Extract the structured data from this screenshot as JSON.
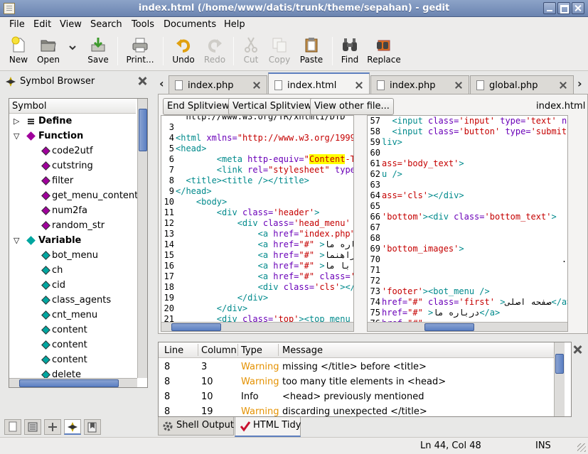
{
  "window": {
    "title": "index.html (/home/www/datis/trunk/theme/sepahan) - gedit"
  },
  "menu": [
    "File",
    "Edit",
    "View",
    "Search",
    "Tools",
    "Documents",
    "Help"
  ],
  "toolbar": {
    "new": "New",
    "open": "Open",
    "save": "Save",
    "print": "Print...",
    "undo": "Undo",
    "redo": "Redo",
    "cut": "Cut",
    "copy": "Copy",
    "paste": "Paste",
    "find": "Find",
    "replace": "Replace"
  },
  "side_panel": {
    "title": "Symbol Browser",
    "column": "Symbol",
    "tree": [
      {
        "label": "Define",
        "kind": "group",
        "expanded": false
      },
      {
        "label": "Function",
        "kind": "group",
        "expanded": true
      },
      {
        "label": "code2utf",
        "kind": "function"
      },
      {
        "label": "cutstring",
        "kind": "function"
      },
      {
        "label": "filter",
        "kind": "function"
      },
      {
        "label": "get_menu_content",
        "kind": "function"
      },
      {
        "label": "num2fa",
        "kind": "function"
      },
      {
        "label": "random_str",
        "kind": "function"
      },
      {
        "label": "Variable",
        "kind": "group",
        "expanded": true
      },
      {
        "label": "bot_menu",
        "kind": "variable"
      },
      {
        "label": "ch",
        "kind": "variable"
      },
      {
        "label": "cid",
        "kind": "variable"
      },
      {
        "label": "class_agents",
        "kind": "variable"
      },
      {
        "label": "cnt_menu",
        "kind": "variable"
      },
      {
        "label": "content",
        "kind": "variable"
      },
      {
        "label": "content",
        "kind": "variable"
      },
      {
        "label": "content",
        "kind": "variable"
      },
      {
        "label": "delete",
        "kind": "variable"
      }
    ]
  },
  "tabs": [
    {
      "label": "index.php",
      "active": false
    },
    {
      "label": "index.html",
      "active": true
    },
    {
      "label": "index.php",
      "active": false
    },
    {
      "label": "global.php",
      "active": false
    }
  ],
  "editor": {
    "buttons": {
      "end": "End Splitview",
      "vertical": "Vertical Splitview",
      "other": "View other file..."
    },
    "filename": "index.html",
    "left_lines": [
      {
        "n": "",
        "html": "  http://www.w3.org/TR/xhtml1/DTD"
      },
      {
        "n": "3",
        "html": ""
      },
      {
        "n": "4",
        "html": "<span class='tg'>&lt;html</span> <span class='at'>xmlns=</span><span class='st'>\"http://www.w3.org/1999/</span>"
      },
      {
        "n": "5",
        "html": "<span class='tg'>&lt;head&gt;</span>"
      },
      {
        "n": "6",
        "html": "        <span class='tg'>&lt;meta</span> <span class='at'>http-equiv=</span><span class='st'>\"<span class='hl'>Content</span>-Ty</span>"
      },
      {
        "n": "7",
        "html": "        <span class='tg'>&lt;link</span> <span class='at'>rel=</span><span class='st'>\"stylesheet\"</span> <span class='at'>type=</span>"
      },
      {
        "n": "8",
        "html": "  <span class='tg'>&lt;title&gt;&lt;title /&gt;&lt;/title&gt;</span>"
      },
      {
        "n": "9",
        "html": "<span class='tg'>&lt;/head&gt;</span>"
      },
      {
        "n": "10",
        "html": "    <span class='tg'>&lt;body&gt;</span>"
      },
      {
        "n": "11",
        "html": "        <span class='tg'>&lt;div</span> <span class='at'>class=</span><span class='st'>'header'</span><span class='tg'>&gt;</span>"
      },
      {
        "n": "12",
        "html": "            <span class='tg'>&lt;div</span> <span class='at'>class=</span><span class='st'>'head_menu'</span> <span class='tg'>&gt;</span>"
      },
      {
        "n": "13",
        "html": "                <span class='tg'>&lt;a</span> <span class='at'>href=</span><span class='st'>\"index.php\"</span>"
      },
      {
        "n": "14",
        "html": "                <span class='tg'>&lt;a</span> <span class='at'>href=</span><span class='st'>\"#\"</span> <span class='tg'>&gt;</span>درباره ما"
      },
      {
        "n": "15",
        "html": "                <span class='tg'>&lt;a</span> <span class='at'>href=</span><span class='st'>\"#\"</span> <span class='tg'>&gt;</span>راهنما"
      },
      {
        "n": "16",
        "html": "                <span class='tg'>&lt;a</span> <span class='at'>href=</span><span class='st'>\"#\"</span> <span class='tg'>&gt;</span>تماس با ما"
      },
      {
        "n": "17",
        "html": "                <span class='tg'>&lt;a</span> <span class='at'>href=</span><span class='st'>\"#\"</span> <span class='at'>class=</span><span class='st'>'f</span>"
      },
      {
        "n": "18",
        "html": "                <span class='tg'>&lt;div</span> <span class='at'>class=</span><span class='st'>'cls'</span><span class='tg'>&gt;&lt;/d</span>"
      },
      {
        "n": "19",
        "html": "            <span class='tg'>&lt;/div&gt;</span>"
      },
      {
        "n": "20",
        "html": "        <span class='tg'>&lt;/div&gt;</span>"
      },
      {
        "n": "21",
        "html": "        <span class='tg'>&lt;div</span> <span class='at'>class=</span><span class='st'>'top'</span><span class='tg'>&gt;&lt;top_menu /</span>"
      }
    ],
    "right_lines": [
      {
        "n": "57",
        "html": "  <span class='tg'>&lt;input</span> <span class='at'>class=</span><span class='st'>'input'</span> <span class='at'>type=</span><span class='st'>'text'</span> <span class='at'>nam</span>"
      },
      {
        "n": "58",
        "html": "  <span class='tg'>&lt;input</span> <span class='at'>class=</span><span class='st'>'button'</span> <span class='at'>type=</span><span class='st'>'submit'</span>"
      },
      {
        "n": "59",
        "html": "<span class='tg'>liv&gt;</span>"
      },
      {
        "n": "60",
        "html": ""
      },
      {
        "n": "61",
        "html": "<span class='st'>ass='body_text'</span><span class='tg'>&gt;</span>"
      },
      {
        "n": "62",
        "html": "<span class='tg'>u /&gt;</span>"
      },
      {
        "n": "63",
        "html": ""
      },
      {
        "n": "64",
        "html": "<span class='st'>ass='cls'</span><span class='tg'>&gt;&lt;/div&gt;</span>"
      },
      {
        "n": "65",
        "html": ""
      },
      {
        "n": "66",
        "html": "<span class='st'>'bottom'</span><span class='tg'>&gt;&lt;div</span> <span class='at'>class=</span><span class='st'>'bottom_text'</span><span class='tg'>&gt;</span>"
      },
      {
        "n": "67",
        "html": ""
      },
      {
        "n": "68",
        "html": ""
      },
      {
        "n": "69",
        "html": "<span class='st'>'bottom_images'</span><span class='tg'>&gt;</span>"
      },
      {
        "n": "70",
        "html": "                                   . ."
      },
      {
        "n": "71",
        "html": ""
      },
      {
        "n": "72",
        "html": ""
      },
      {
        "n": "73",
        "html": "<span class='st'>'footer'</span><span class='tg'>&gt;&lt;bot_menu /&gt;</span>"
      },
      {
        "n": "74",
        "html": "<span class='at'>href=</span><span class='st'>\"#\"</span> <span class='at'>class=</span><span class='st'>'first'</span> <span class='tg'>&gt;</span>صفحه اصلی<span class='tg'>&lt;/a&gt;</span>"
      },
      {
        "n": "75",
        "html": "<span class='at'>href=</span><span class='st'>\"#\"</span> <span class='tg'>&gt;</span>درباره ما<span class='tg'>&lt;/a&gt;</span>"
      },
      {
        "n": "76",
        "html": "<span class='at'>href=</span><span class='st'>\"#\"</span>"
      }
    ]
  },
  "messages": {
    "columns": [
      "Line",
      "Column",
      "Type",
      "Message"
    ],
    "rows": [
      {
        "line": "8",
        "column": "3",
        "type": "Warning",
        "message": "missing </title> before <title>"
      },
      {
        "line": "8",
        "column": "10",
        "type": "Warning",
        "message": "too many title elements in <head>"
      },
      {
        "line": "8",
        "column": "10",
        "type": "Info",
        "message": "<head> previously mentioned"
      },
      {
        "line": "8",
        "column": "19",
        "type": "Warning",
        "message": "discarding unexpected </title>"
      }
    ]
  },
  "bottom_tabs": [
    "Shell Output",
    "HTML Tidy"
  ],
  "statusbar": {
    "position": "Ln 44, Col 48",
    "mode": "INS"
  },
  "colors": {
    "accent": "#5e7fbf",
    "warning": "#e49100",
    "tag": "#008a8c",
    "attr": "#6a00b8",
    "string": "#c50000"
  }
}
